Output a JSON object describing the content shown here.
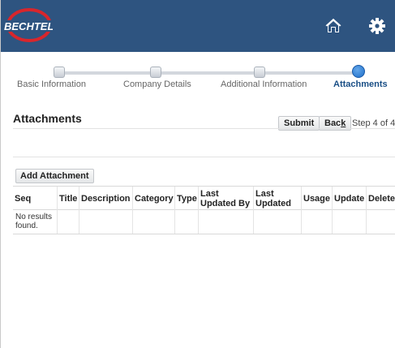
{
  "header": {
    "logo_text": "BECHTEL",
    "home_icon": "home-icon",
    "settings_icon": "gear-icon",
    "bg_color": "#2e5480",
    "logo_color": "#d8262c"
  },
  "train": {
    "steps": [
      {
        "label": "Basic Information",
        "state": "done"
      },
      {
        "label": "Company Details",
        "state": "done"
      },
      {
        "label": "Additional Information",
        "state": "done"
      },
      {
        "label": "Attachments",
        "state": "current"
      }
    ]
  },
  "actions": {
    "submit_label": "Submit",
    "back_label_prefix": "Bac",
    "back_label_mnemonic": "k",
    "step_text": "Step 4 of 4"
  },
  "page": {
    "title": "Attachments",
    "add_button_label": "Add Attachment"
  },
  "table": {
    "columns": [
      "Seq",
      "Title",
      "Description",
      "Category",
      "Type",
      "Last Updated By",
      "Last Updated",
      "Usage",
      "Update",
      "Delete"
    ],
    "empty_message": "No results found."
  }
}
